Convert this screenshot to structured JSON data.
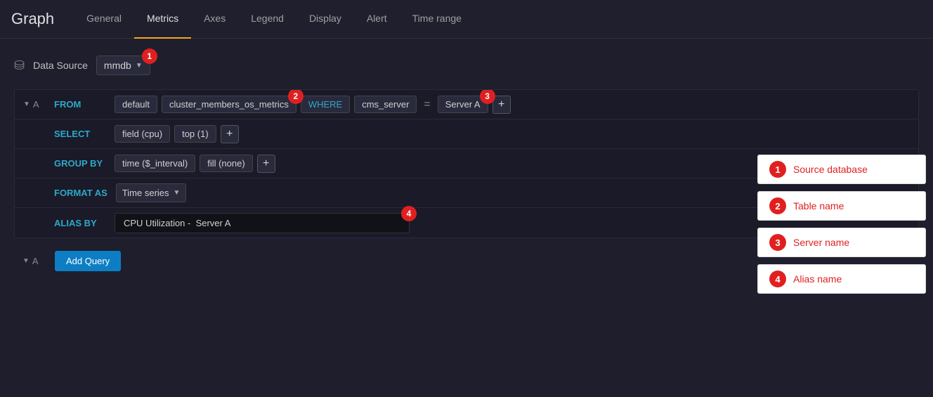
{
  "title": "Graph",
  "tabs": [
    {
      "id": "general",
      "label": "General",
      "active": false
    },
    {
      "id": "metrics",
      "label": "Metrics",
      "active": true
    },
    {
      "id": "axes",
      "label": "Axes",
      "active": false
    },
    {
      "id": "legend",
      "label": "Legend",
      "active": false
    },
    {
      "id": "display",
      "label": "Display",
      "active": false
    },
    {
      "id": "alert",
      "label": "Alert",
      "active": false
    },
    {
      "id": "time_range",
      "label": "Time range",
      "active": false
    }
  ],
  "datasource": {
    "label": "Data Source",
    "value": "mmdb",
    "badge": "1"
  },
  "query": {
    "prefix": "A",
    "from": {
      "label": "FROM",
      "schema": "default",
      "table": "cluster_members_os_metrics",
      "table_badge": "2",
      "where_label": "WHERE",
      "field": "cms_server",
      "equals": "=",
      "value": "Server A",
      "value_badge": "3",
      "add_btn": "+"
    },
    "select": {
      "label": "SELECT",
      "field": "field (cpu)",
      "func": "top (1)",
      "add_btn": "+"
    },
    "group_by": {
      "label": "GROUP BY",
      "time": "time ($_interval)",
      "fill": "fill (none)",
      "add_btn": "+"
    },
    "format_as": {
      "label": "FORMAT AS",
      "value": "Time series",
      "chevron": "▼"
    },
    "alias_by": {
      "label": "ALIAS BY",
      "value": "CPU Utilization -  Server A",
      "badge": "4"
    }
  },
  "add_query_btn": "Add Query",
  "annotations": [
    {
      "number": "1",
      "text": "Source database"
    },
    {
      "number": "2",
      "text": "Table name"
    },
    {
      "number": "3",
      "text": "Server name"
    },
    {
      "number": "4",
      "text": "Alias name"
    }
  ]
}
